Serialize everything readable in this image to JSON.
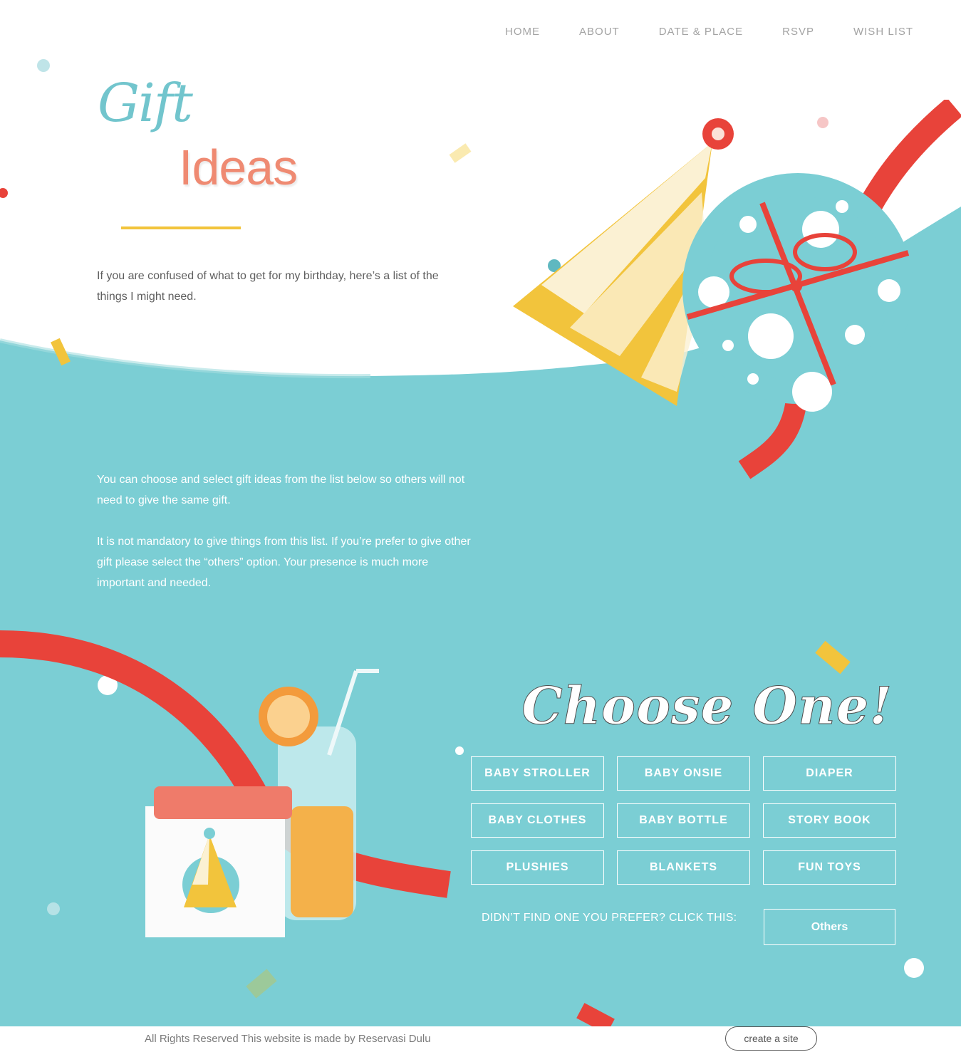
{
  "nav": {
    "items": [
      {
        "label": "HOME"
      },
      {
        "label": "ABOUT"
      },
      {
        "label": "DATE & PLACE"
      },
      {
        "label": "RSVP"
      },
      {
        "label": "WISH LIST"
      }
    ]
  },
  "hero": {
    "title_script": "Gift",
    "title_main": "Ideas",
    "intro": "If you are confused of what to get for my birthday, here’s a list of the things I might need."
  },
  "main": {
    "paragraph1": "You can choose and select gift ideas from the list below so others will not need to give the same gift.",
    "paragraph2": "It is not mandatory to give things from this list. If you’re prefer to give other gift please select the “others” option. Your presence is much more important and needed.",
    "choose_heading": "Choose One!",
    "gift_options": [
      "BABY STROLLER",
      "BABY ONSIE",
      "DIAPER",
      "BABY CLOTHES",
      "BABY BOTTLE",
      "STORY BOOK",
      "PLUSHIES",
      "BLANKETS",
      "FUN TOYS"
    ],
    "prefer_text": "DIDN’T FIND ONE YOU PREFER? CLICK THIS:",
    "others_label": "Others"
  },
  "footer": {
    "copyright": "All Rights Reserved This website is made by Reservasi Dulu",
    "create_site": "create a site"
  },
  "colors": {
    "teal": "#7bced4",
    "coral": "#ef8a72",
    "script_teal": "#72c5cd",
    "yellow": "#f2c43c",
    "ribbon_red": "#e8433a"
  },
  "icons": [
    "party-hat-icon",
    "gift-box-icon",
    "calendar-icon",
    "juice-bottle-icon",
    "orange-slice-icon"
  ]
}
